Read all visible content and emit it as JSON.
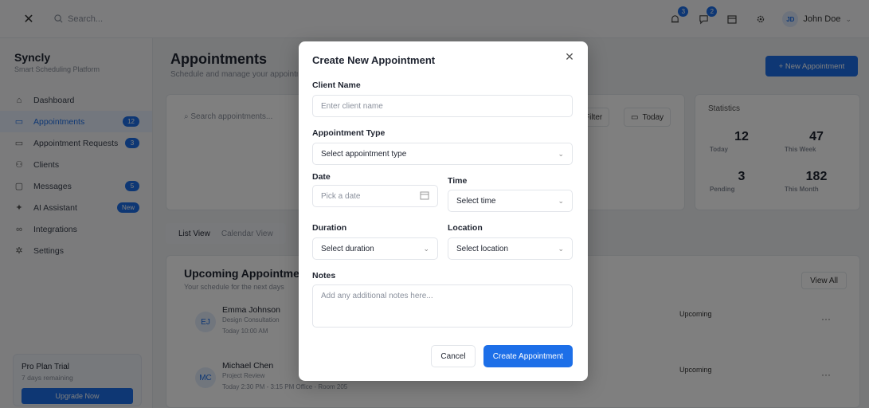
{
  "colors": {
    "accent": "#1d6fe8",
    "overlay": "rgba(0,0,0,0.5)"
  },
  "topbar": {
    "search_placeholder": "Search...",
    "notifications_count": "3",
    "messages_count": "2",
    "user_initials": "JD",
    "user_name": "John Doe"
  },
  "sidebar": {
    "brand": "Syncly",
    "tagline": "Smart Scheduling Platform",
    "items": [
      {
        "label": "Dashboard",
        "icon": "home-icon"
      },
      {
        "label": "Appointments",
        "icon": "calendar-icon",
        "badge": "12"
      },
      {
        "label": "Appointment Requests",
        "icon": "calendar-icon",
        "badge": "3"
      },
      {
        "label": "Clients",
        "icon": "users-icon"
      },
      {
        "label": "Messages",
        "icon": "message-icon",
        "badge": "5"
      },
      {
        "label": "AI Assistant",
        "icon": "sparkle-icon",
        "badge": "New"
      },
      {
        "label": "Integrations",
        "icon": "link-icon"
      },
      {
        "label": "Settings",
        "icon": "gear-icon"
      }
    ],
    "trial": {
      "title": "Pro Plan Trial",
      "remaining": "7 days remaining",
      "cta": "Upgrade Now"
    }
  },
  "main": {
    "title": "Appointments",
    "subtitle": "Schedule and manage your appointments",
    "new_button": "+ New Appointment",
    "search_placeholder": "Search appointments...",
    "filter_label": "Filter",
    "today_label": "Today",
    "tabs": [
      "List View",
      "Calendar View"
    ]
  },
  "stats": {
    "title": "Statistics",
    "items": [
      {
        "value": "12",
        "label": "Today"
      },
      {
        "value": "47",
        "label": "This Week"
      },
      {
        "value": "3",
        "label": "Pending"
      },
      {
        "value": "182",
        "label": "This Month"
      }
    ]
  },
  "upcoming": {
    "title": "Upcoming Appointments",
    "subtitle": "Your schedule for the next days",
    "view_all": "View All",
    "rows": [
      {
        "initials": "EJ",
        "name": "Emma Johnson",
        "type": "Design Consultation",
        "time": "Today   10:00 AM",
        "status": "Upcoming"
      },
      {
        "initials": "MC",
        "name": "Michael Chen",
        "type": "Project Review",
        "time": "Today   2:30 PM - 3:15 PM   Office - Room 205",
        "status": "Upcoming"
      }
    ]
  },
  "modal": {
    "title": "Create New Appointment",
    "client_name_label": "Client Name",
    "client_name_placeholder": "Enter client name",
    "type_label": "Appointment Type",
    "type_value": "Select appointment type",
    "date_label": "Date",
    "date_placeholder": "Pick a date",
    "time_label": "Time",
    "time_value": "Select time",
    "duration_label": "Duration",
    "duration_value": "Select duration",
    "location_label": "Location",
    "location_value": "Select location",
    "notes_label": "Notes",
    "notes_placeholder": "Add any additional notes here...",
    "cancel": "Cancel",
    "create": "Create Appointment"
  }
}
